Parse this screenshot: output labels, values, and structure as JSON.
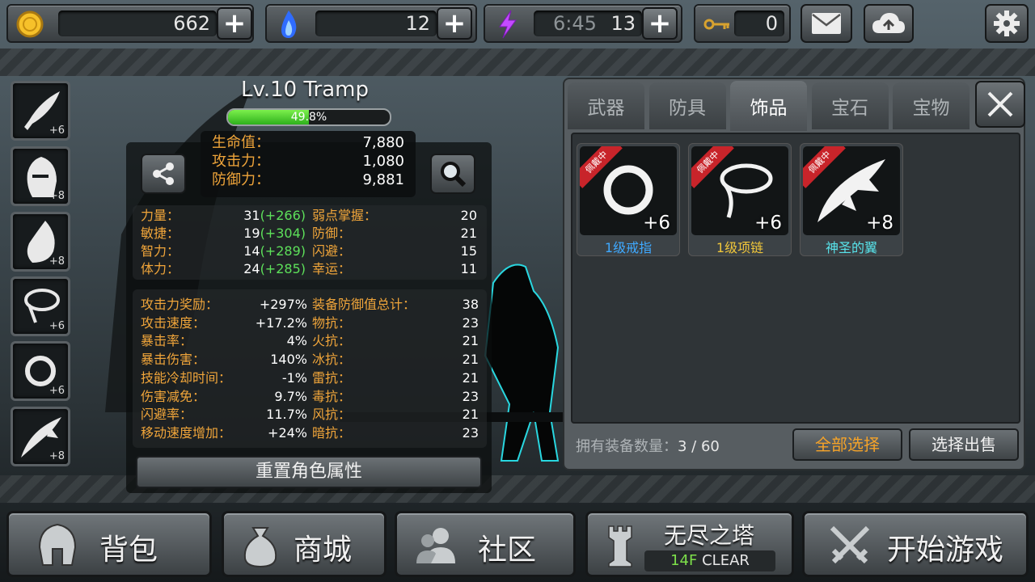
{
  "topbar": {
    "gold": "662",
    "soul": "12",
    "energy_timer": "6:45",
    "energy": "13",
    "keys": "0"
  },
  "character": {
    "name": "Lv.10 Tramp",
    "exp_percent": "49.8%",
    "exp_fraction": 0.498
  },
  "summary": [
    {
      "label": "生命值：",
      "value": "7,880"
    },
    {
      "label": "攻击力：",
      "value": "1,080"
    },
    {
      "label": "防御力：",
      "value": "9,881"
    }
  ],
  "attributes_left": [
    {
      "label": "力量：",
      "base": "31",
      "bonus": "(+266)"
    },
    {
      "label": "敏捷：",
      "base": "19",
      "bonus": "(+304)"
    },
    {
      "label": "智力：",
      "base": "14",
      "bonus": "(+289)"
    },
    {
      "label": "体力：",
      "base": "24",
      "bonus": "(+285)"
    }
  ],
  "attributes_right": [
    {
      "label": "弱点掌握：",
      "value": "20"
    },
    {
      "label": "防御：",
      "value": "21"
    },
    {
      "label": "闪避：",
      "value": "15"
    },
    {
      "label": "幸运：",
      "value": "11"
    }
  ],
  "stats_left": [
    {
      "label": "攻击力奖励：",
      "value": "+297%"
    },
    {
      "label": "攻击速度：",
      "value": "+17.2%"
    },
    {
      "label": "暴击率：",
      "value": "4%"
    },
    {
      "label": "暴击伤害：",
      "value": "140%"
    },
    {
      "label": "技能冷却时间：",
      "value": "-1%"
    },
    {
      "label": "伤害减免：",
      "value": "9.7%"
    },
    {
      "label": "闪避率：",
      "value": "11.7%"
    },
    {
      "label": "移动速度增加：",
      "value": "+24%"
    }
  ],
  "stats_right": [
    {
      "label": "装备防御值总计：",
      "value": "38"
    },
    {
      "label": "物抗：",
      "value": "23"
    },
    {
      "label": "火抗：",
      "value": "21"
    },
    {
      "label": "冰抗：",
      "value": "21"
    },
    {
      "label": "雷抗：",
      "value": "21"
    },
    {
      "label": "毒抗：",
      "value": "23"
    },
    {
      "label": "风抗：",
      "value": "21"
    },
    {
      "label": "暗抗：",
      "value": "23"
    }
  ],
  "reset_button": "重置角色属性",
  "slots": [
    "+6",
    "+8",
    "+8",
    "+6",
    "+6",
    "+8"
  ],
  "tabs": [
    "武器",
    "防具",
    "饰品",
    "宝石",
    "宝物"
  ],
  "active_tab": "饰品",
  "items": [
    {
      "name": "1级戒指",
      "level": "+6",
      "badge": "佩戴中",
      "color": "#3fa9ff"
    },
    {
      "name": "1级项链",
      "level": "+6",
      "badge": "佩戴中",
      "color": "#f0c63a"
    },
    {
      "name": "神圣的翼",
      "level": "+8",
      "badge": "佩戴中",
      "color": "#58e3ea"
    }
  ],
  "inventory": {
    "count_label": "拥有装备数量：",
    "count": "3 / 60",
    "select_all": "全部选择",
    "sell": "选择出售"
  },
  "bottom": {
    "bag": "背包",
    "shop": "商城",
    "community": "社区",
    "tower": "无尽之塔",
    "tower_floor": "14F",
    "tower_status": "CLEAR",
    "start": "开始游戏"
  }
}
